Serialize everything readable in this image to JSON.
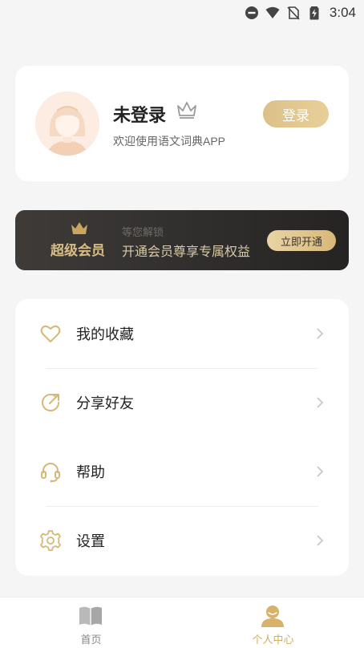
{
  "status_bar": {
    "time": "3:04",
    "icons": [
      "do-not-disturb-icon",
      "wifi-icon",
      "no-sim-icon",
      "battery-charging-icon"
    ]
  },
  "profile": {
    "username": "未登录",
    "welcome": "欢迎使用语文词典APP",
    "login_label": "登录",
    "icons": [
      "avatar",
      "crown-outline-icon"
    ]
  },
  "vip": {
    "title": "超级会员",
    "subtitle": "等您解锁",
    "description": "开通会员尊享专属权益",
    "button_label": "立即开通",
    "icon": "crown-icon"
  },
  "menu": {
    "items": [
      {
        "label": "我的收藏",
        "icon": "heart-icon"
      },
      {
        "label": "分享好友",
        "icon": "share-icon"
      },
      {
        "label": "帮助",
        "icon": "headset-icon"
      },
      {
        "label": "设置",
        "icon": "gear-icon"
      }
    ]
  },
  "nav": {
    "items": [
      {
        "label": "首页",
        "icon": "book-icon",
        "active": false
      },
      {
        "label": "个人中心",
        "icon": "user-icon",
        "active": true
      }
    ]
  },
  "colors": {
    "accent_gold": "#d8b877",
    "vip_bg": "#2f2d2b",
    "background": "#f5f5f5"
  }
}
